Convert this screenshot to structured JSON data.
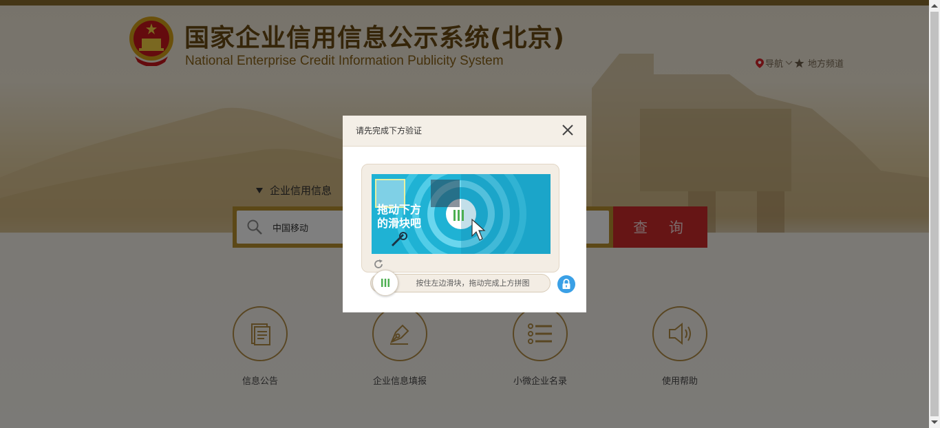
{
  "header": {
    "title": "国家企业信用信息公示系统(北京)",
    "subtitle": "National Enterprise Credit Information Publicity System",
    "nav_label": "导航",
    "channel_label": "地方频道"
  },
  "search": {
    "type_label": "企业信用信息",
    "value": "中国移动",
    "button_label": "查 询"
  },
  "features": [
    {
      "label": "信息公告",
      "icon": "document-icon"
    },
    {
      "label": "企业信息填报",
      "icon": "pen-icon"
    },
    {
      "label": "小微企业名录",
      "icon": "list-icon"
    },
    {
      "label": "使用帮助",
      "icon": "speaker-icon"
    }
  ],
  "modal": {
    "title": "请先完成下方验证",
    "captcha_text_line1": "拖动下方",
    "captcha_text_line2": "的滑块吧",
    "slider_hint": "按住左边滑块，拖动完成上方拼图"
  },
  "colors": {
    "brand_gold": "#b8902e",
    "title_brown": "#6b4a12",
    "search_red": "#cc2b2b",
    "captcha_blue": "#21b4d6",
    "lock_blue": "#3aa0e6"
  }
}
